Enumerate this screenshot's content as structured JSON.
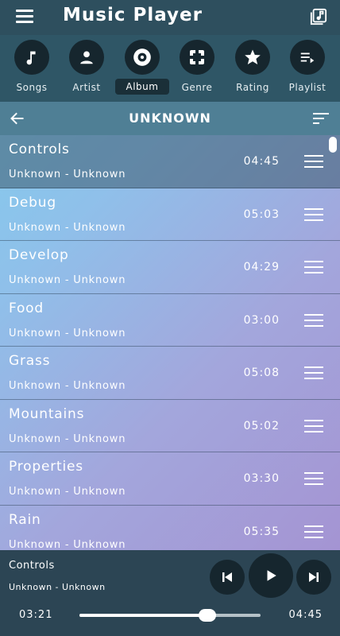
{
  "header": {
    "title": "Music Player"
  },
  "categories": [
    {
      "label": "Songs",
      "icon": "music-note-icon",
      "active": false
    },
    {
      "label": "Artist",
      "icon": "person-icon",
      "active": false
    },
    {
      "label": "Album",
      "icon": "disc-icon",
      "active": true
    },
    {
      "label": "Genre",
      "icon": "genre-icon",
      "active": false
    },
    {
      "label": "Rating",
      "icon": "star-icon",
      "active": false
    },
    {
      "label": "Playlist",
      "icon": "playlist-icon",
      "active": false
    }
  ],
  "subheader": {
    "title": "UNKNOWN"
  },
  "tracks": [
    {
      "title": "Controls",
      "subtitle": "Unknown - Unknown",
      "duration": "04:45"
    },
    {
      "title": "Debug",
      "subtitle": "Unknown - Unknown",
      "duration": "05:03"
    },
    {
      "title": "Develop",
      "subtitle": "Unknown - Unknown",
      "duration": "04:29"
    },
    {
      "title": "Food",
      "subtitle": "Unknown - Unknown",
      "duration": "03:00"
    },
    {
      "title": "Grass",
      "subtitle": "Unknown - Unknown",
      "duration": "05:08"
    },
    {
      "title": "Mountains",
      "subtitle": "Unknown - Unknown",
      "duration": "05:02"
    },
    {
      "title": "Properties",
      "subtitle": "Unknown - Unknown",
      "duration": "03:30"
    },
    {
      "title": "Rain",
      "subtitle": "Unknown - Unknown",
      "duration": "05:35"
    }
  ],
  "player": {
    "title": "Controls",
    "subtitle": "Unknown - Unknown",
    "current_time": "03:21",
    "total_time": "04:45",
    "progress": 0.705
  },
  "colors": {
    "topbar": "#2e4f5e",
    "categories_bar": "#2f5666",
    "subheader": "#4f7f95",
    "player_bar": "#2c4554",
    "button_dark": "#16262e"
  }
}
